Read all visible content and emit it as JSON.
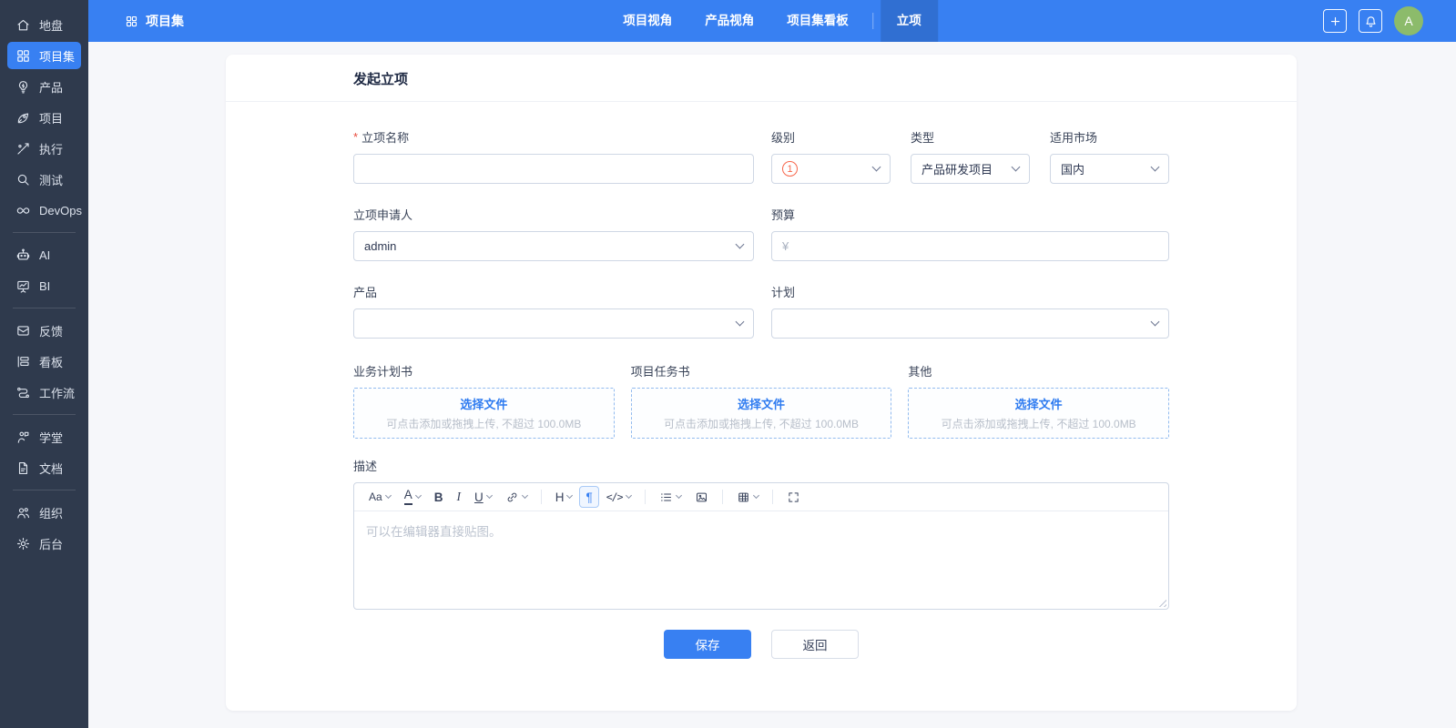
{
  "colors": {
    "accent_blue": "#3880F2",
    "sidebar_bg": "#2F3A4D",
    "page_bg": "#F6F7FA",
    "level_badge_orange": "#F7664B",
    "avatar_green": "#8CBB6B",
    "upload_dash_blue": "#92BBEF"
  },
  "sidebar": {
    "groups": [
      {
        "items": [
          {
            "label": "地盘"
          },
          {
            "label": "项目集",
            "active": true
          },
          {
            "label": "产品"
          },
          {
            "label": "项目"
          },
          {
            "label": "执行"
          },
          {
            "label": "测试"
          },
          {
            "label": "DevOps"
          }
        ]
      },
      {
        "items": [
          {
            "label": "AI"
          },
          {
            "label": "BI"
          }
        ]
      },
      {
        "items": [
          {
            "label": "反馈"
          },
          {
            "label": "看板"
          },
          {
            "label": "工作流"
          }
        ]
      },
      {
        "items": [
          {
            "label": "学堂"
          },
          {
            "label": "文档"
          }
        ]
      },
      {
        "items": [
          {
            "label": "组织"
          },
          {
            "label": "后台"
          }
        ]
      }
    ]
  },
  "header": {
    "app_title": "项目集",
    "tabs": [
      "项目视角",
      "产品视角",
      "项目集看板",
      "立项"
    ],
    "active_tab": "立项",
    "avatar": "A"
  },
  "form": {
    "title": "发起立项",
    "required_mark": "*",
    "name_label": "立项名称",
    "name_value": "",
    "level_label": "级别",
    "level_badge": "1",
    "type_label": "类型",
    "type_value": "产品研发项目",
    "market_label": "适用市场",
    "market_value": "国内",
    "applicant_label": "立项申请人",
    "applicant_value": "admin",
    "budget_label": "预算",
    "budget_prefix": "¥",
    "budget_value": "",
    "product_label": "产品",
    "product_value": "",
    "plan_label": "计划",
    "plan_value": "",
    "upload_fields": [
      {
        "label": "业务计划书"
      },
      {
        "label": "项目任务书"
      },
      {
        "label": "其他"
      }
    ],
    "upload_button": "选择文件",
    "upload_hint": "可点击添加或拖拽上传, 不超过 100.0MB",
    "desc_label": "描述",
    "editor_placeholder": "可以在编辑器直接贴图。",
    "toolbar": {
      "font": "Aa",
      "color": "A",
      "bold": "B",
      "italic": "I",
      "underline": "U",
      "heading": "H",
      "paragraph": "¶",
      "code": "</>"
    },
    "save": "保存",
    "back": "返回"
  }
}
